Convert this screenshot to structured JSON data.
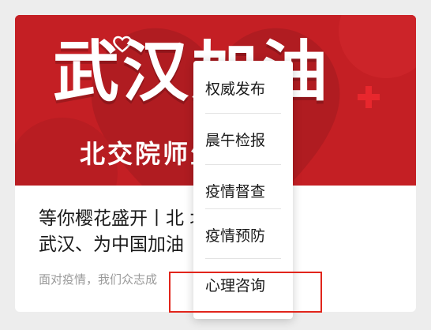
{
  "banner": {
    "title": "武汉加油",
    "subtitle": "北交院师生 武汉"
  },
  "article": {
    "title_line1": "等你樱花盛开丨北 北交院为",
    "title_line2": "武汉、为中国加油",
    "summary": "面对疫情，我们众志成"
  },
  "menu": {
    "items": [
      "权威发布",
      "晨午检报",
      "疫情督查",
      "疫情预防",
      "心理咨询"
    ],
    "highlighted_item": "心理咨询"
  },
  "colors": {
    "banner_red": "#c41f24",
    "highlight_border": "#e1251b",
    "background": "#ededed"
  }
}
